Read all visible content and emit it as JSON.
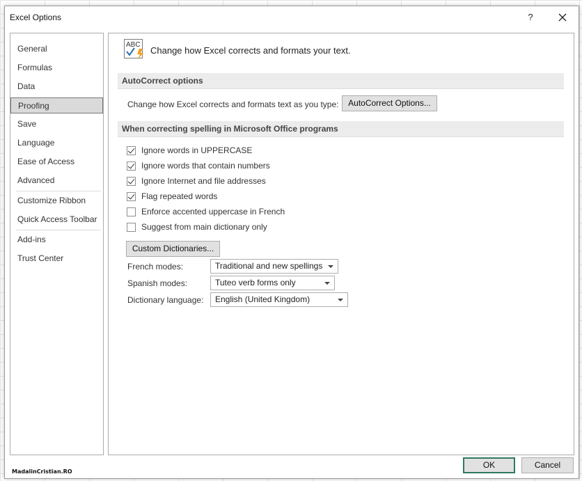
{
  "window": {
    "title": "Excel Options",
    "help_label": "?"
  },
  "sidebar": {
    "items": [
      {
        "label": "General"
      },
      {
        "label": "Formulas"
      },
      {
        "label": "Data"
      },
      {
        "label": "Proofing",
        "active": true
      },
      {
        "label": "Save"
      },
      {
        "label": "Language"
      },
      {
        "label": "Ease of Access"
      },
      {
        "label": "Advanced"
      },
      {
        "label": "Customize Ribbon"
      },
      {
        "label": "Quick Access Toolbar"
      },
      {
        "label": "Add-ins"
      },
      {
        "label": "Trust Center"
      }
    ]
  },
  "main": {
    "header_icon": "abc-check-icon",
    "header_text": "Change how Excel corrects and formats your text.",
    "autocorrect": {
      "section_title": "AutoCorrect options",
      "description": "Change how Excel corrects and formats text as you type:",
      "button_label": "AutoCorrect Options..."
    },
    "spelling": {
      "section_title": "When correcting spelling in Microsoft Office programs",
      "options": [
        {
          "label": "Ignore words in UPPERCASE",
          "checked": true
        },
        {
          "label": "Ignore words that contain numbers",
          "checked": true
        },
        {
          "label": "Ignore Internet and file addresses",
          "checked": true
        },
        {
          "label": "Flag repeated words",
          "checked": true
        },
        {
          "label": "Enforce accented uppercase in French",
          "checked": false
        },
        {
          "label": "Suggest from main dictionary only",
          "checked": false
        }
      ],
      "custom_dictionaries_label": "Custom Dictionaries...",
      "french_modes": {
        "label": "French modes:",
        "value": "Traditional and new spellings"
      },
      "spanish_modes": {
        "label": "Spanish modes:",
        "value": "Tuteo verb forms only"
      },
      "dictionary_language": {
        "label": "Dictionary language:",
        "value": "English (United Kingdom)"
      }
    }
  },
  "footer": {
    "ok_label": "OK",
    "cancel_label": "Cancel",
    "watermark": "MadalinCristian.RO"
  },
  "colors": {
    "active_nav_bg": "#dadada",
    "section_bg": "#ececec",
    "ok_border": "#2e7a5f"
  }
}
